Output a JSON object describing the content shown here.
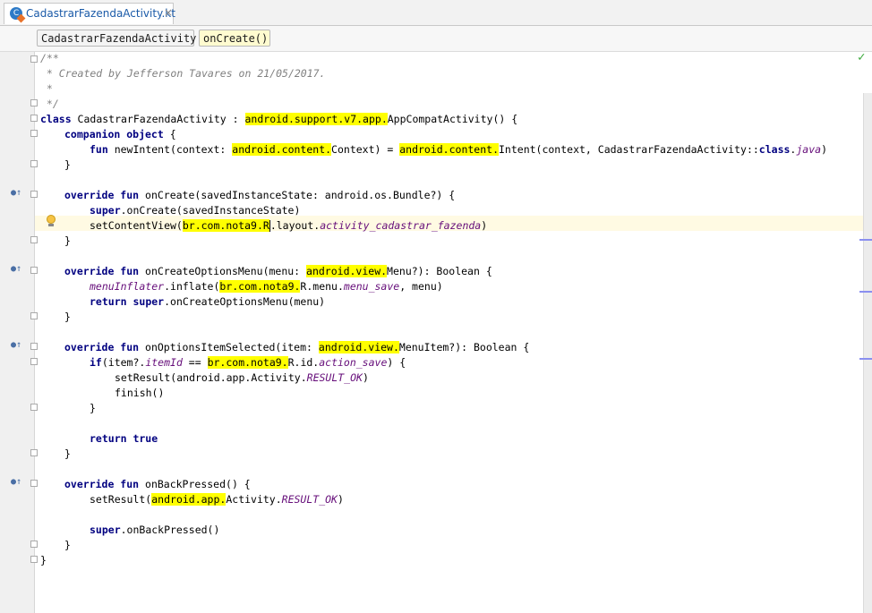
{
  "tab": {
    "title": "CadastrarFazendaActivity.kt",
    "icon": "kotlin-file-icon",
    "close": "×"
  },
  "breadcrumbs": [
    "CadastrarFazendaActivity",
    "onCreate()"
  ],
  "status_icon": "inspection-ok-icon",
  "code": {
    "l1": "/**",
    "l2": " * Created by Jefferson Tavares on 21/05/2017.",
    "l3": " *",
    "l4": " */",
    "class_kw": "class",
    "class_name": " CadastrarFazendaActivity : ",
    "class_pkg": "android.support.v7.app.",
    "class_tail": "AppCompatActivity() {",
    "comp": "companion object",
    "comp_tail": " {",
    "fun_kw": "fun",
    "newintent_a": " newIntent(context: ",
    "newintent_pkg": "android.content.",
    "newintent_b": "Context) = ",
    "newintent_pkg2": "android.content.",
    "newintent_c": "Intent(context, CadastrarFazendaActivity::",
    "newintent_class": "class",
    "newintent_dot": ".",
    "newintent_java": "java",
    "newintent_end": ")",
    "close": "}",
    "override_fun": "override fun",
    "oncreate_sig": " onCreate(savedInstanceState: android.os.Bundle?) {",
    "super_kw": "super",
    "oncreate_super": ".onCreate(savedInstanceState)",
    "setcv_a": "setContentView(",
    "setcv_pkg": "br.com.nota9.",
    "setcv_r": "R",
    "setcv_b": ".layout.",
    "setcv_it": "activity_cadastrar_fazenda",
    "setcv_end": ")",
    "ocom_a": " onCreateOptionsMenu(menu: ",
    "ocom_pkg": "android.view.",
    "ocom_b": "Menu?): Boolean {",
    "menuinfl": "menuInflater",
    "infl_a": ".inflate(",
    "infl_pkg": "br.com.nota9.",
    "infl_b": "R.menu.",
    "infl_it": "menu_save",
    "infl_c": ", menu)",
    "return_kw": "return",
    "ret_super": " super",
    "ret_ocom": ".onCreateOptionsMenu(menu)",
    "ois_a": " onOptionsItemSelected(item: ",
    "ois_pkg": "android.view.",
    "ois_b": "MenuItem?): Boolean {",
    "if_kw": "if",
    "if_a": "(item?.",
    "if_it": "itemId",
    "if_b": " == ",
    "if_pkg": "br.com.nota9.",
    "if_c": "R.id.",
    "if_it2": "action_save",
    "if_d": ") {",
    "setres_a": "setResult(android.app.Activity.",
    "setres_it": "RESULT_OK",
    "setres_end": ")",
    "finish": "finish()",
    "ret_true_kw": "return true",
    "obp": " onBackPressed() {",
    "setres2_a": "setResult(",
    "setres2_pkg": "android.app.",
    "setres2_b": "Activity.",
    "setres2_it": "RESULT_OK",
    "setres2_end": ")",
    "super_obp": ".onBackPressed()"
  }
}
